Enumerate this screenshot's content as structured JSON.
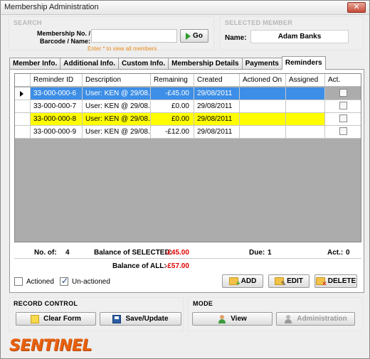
{
  "window": {
    "title": "Membership Administration",
    "close_glyph": "✕"
  },
  "search": {
    "section_title": "SEARCH",
    "label": "Membership No. / Barcode / Name:",
    "input_value": "",
    "go_label": "Go",
    "hint": "Enter * to view all members"
  },
  "selected_member": {
    "section_title": "SELECTED MEMBER",
    "name_label": "Name:",
    "name_value": "Adam Banks"
  },
  "tabs": [
    {
      "label": "Member Info.",
      "active": false
    },
    {
      "label": "Additional Info.",
      "active": false
    },
    {
      "label": "Custom Info.",
      "active": false
    },
    {
      "label": "Membership Details",
      "active": false
    },
    {
      "label": "Payments",
      "active": false
    },
    {
      "label": "Reminders",
      "active": true
    }
  ],
  "grid": {
    "columns": [
      "Reminder ID",
      "Description",
      "Remaining",
      "Created",
      "Actioned On",
      "Assigned",
      "Act."
    ],
    "rows": [
      {
        "id": "33-000-000-6",
        "description": "User: KEN @ 29/08...",
        "remaining": "-£45.00",
        "created": "29/08/2011",
        "actioned_on": "",
        "assigned": "",
        "act": false,
        "state": "selected"
      },
      {
        "id": "33-000-000-7",
        "description": "User: KEN @ 29/08...",
        "remaining": "£0.00",
        "created": "29/08/2011",
        "actioned_on": "",
        "assigned": "",
        "act": false,
        "state": "normal"
      },
      {
        "id": "33-000-000-8",
        "description": "User: KEN @ 29/08...",
        "remaining": "£0.00",
        "created": "29/08/2011",
        "actioned_on": "",
        "assigned": "",
        "act": false,
        "state": "highlight"
      },
      {
        "id": "33-000-000-9",
        "description": "User: KEN @ 29/08...",
        "remaining": "-£12.00",
        "created": "29/08/2011",
        "actioned_on": "",
        "assigned": "",
        "act": false,
        "state": "normal"
      }
    ]
  },
  "summary": {
    "no_of_label": "No. of:",
    "no_of_value": "4",
    "balance_selected_label": "Balance of SELECTED:",
    "balance_selected_value": "-£45.00",
    "due_label": "Due:",
    "due_value": "1",
    "act_label": "Act.:",
    "act_value": "0",
    "balance_all_label": "Balance of ALL:",
    "balance_all_value": "-£57.00"
  },
  "filters": {
    "actioned_label": "Actioned",
    "actioned_checked": false,
    "unactioned_label": "Un-actioned",
    "unactioned_checked": true
  },
  "actions": {
    "add_label": "ADD",
    "edit_label": "EDIT",
    "delete_label": "DELETE"
  },
  "record_control": {
    "section_title": "RECORD CONTROL",
    "clear_label": "Clear Form",
    "save_label": "Save/Update"
  },
  "mode": {
    "section_title": "MODE",
    "view_label": "View",
    "admin_label": "Administration"
  },
  "branding": {
    "logo_text": "SENTINEL"
  },
  "colors": {
    "selected_row": "#3d8ee6",
    "highlight_row": "#fffd00",
    "negative": "#e00000",
    "logo": "#e8600e"
  }
}
